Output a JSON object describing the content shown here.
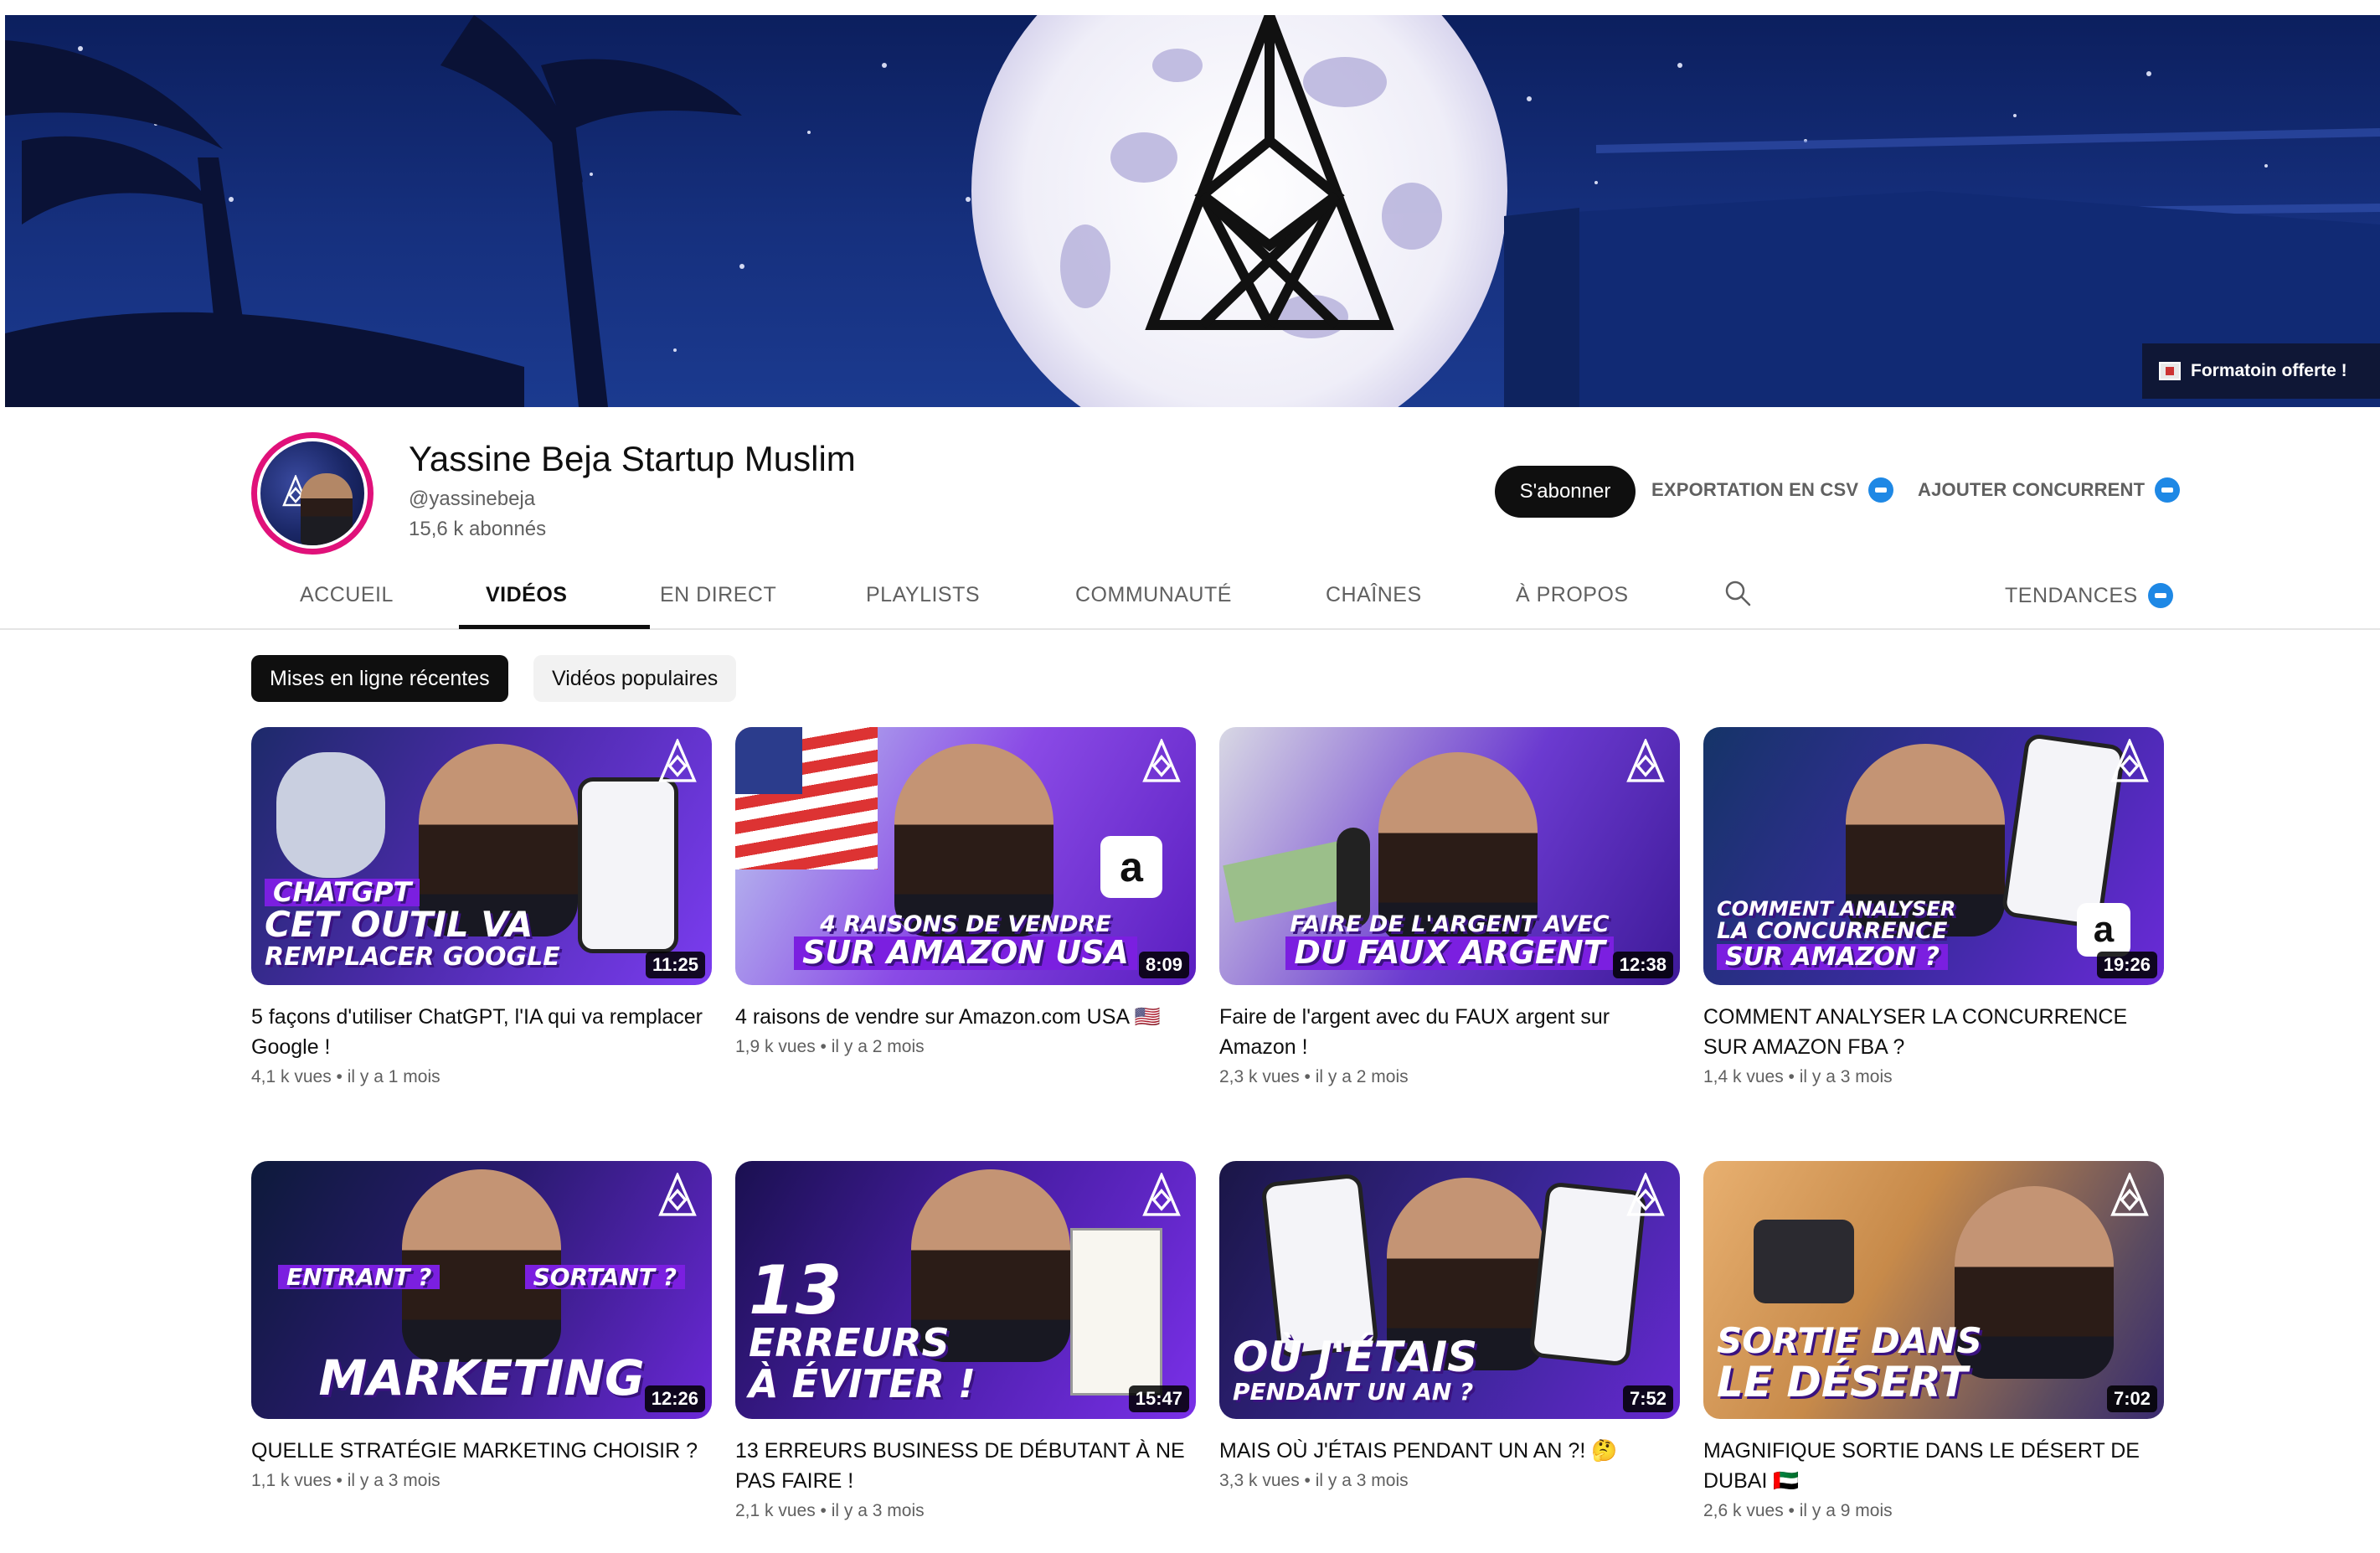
{
  "banner": {
    "promo_label": "Formatoin offerte !"
  },
  "channel": {
    "name": "Yassine Beja Startup Muslim",
    "handle": "@yassinebeja",
    "subscribers": "15,6 k abonnés"
  },
  "actions": {
    "subscribe_label": "S'abonner",
    "export_label": "EXPORTATION EN CSV",
    "add_competitor_label": "AJOUTER CONCURRENT"
  },
  "tabs": [
    {
      "label": "ACCUEIL"
    },
    {
      "label": "VIDÉOS"
    },
    {
      "label": "EN DIRECT"
    },
    {
      "label": "PLAYLISTS"
    },
    {
      "label": "COMMUNAUTÉ"
    },
    {
      "label": "CHAÎNES"
    },
    {
      "label": "À PROPOS"
    }
  ],
  "trends_label": "TENDANCES",
  "chips": [
    {
      "label": "Mises en ligne récentes"
    },
    {
      "label": "Vidéos populaires"
    }
  ],
  "videos": [
    {
      "title": "5 façons d'utiliser ChatGPT, l'IA qui va remplacer Google !",
      "meta": "4,1 k vues • il y a 1 mois",
      "duration": "11:25",
      "thumb_lines": [
        "CHATGPT",
        "CET OUTIL VA",
        "REMPLACER GOOGLE"
      ]
    },
    {
      "title": "4 raisons de vendre sur Amazon.com USA 🇺🇸",
      "meta": "1,9 k vues • il y a 2 mois",
      "duration": "8:09",
      "thumb_lines": [
        "4 RAISONS DE VENDRE",
        "SUR AMAZON USA"
      ]
    },
    {
      "title": "Faire de l'argent avec du FAUX argent sur Amazon !",
      "meta": "2,3 k vues • il y a 2 mois",
      "duration": "12:38",
      "thumb_lines": [
        "FAIRE DE L'ARGENT AVEC",
        "DU FAUX ARGENT"
      ]
    },
    {
      "title": "COMMENT ANALYSER LA CONCURRENCE SUR AMAZON FBA ?",
      "meta": "1,4 k vues • il y a 3 mois",
      "duration": "19:26",
      "thumb_lines": [
        "COMMENT ANALYSER",
        "LA CONCURRENCE",
        "SUR AMAZON ?"
      ]
    },
    {
      "title": "QUELLE STRATÉGIE MARKETING CHOISIR ?",
      "meta": "1,1 k vues • il y a 3 mois",
      "duration": "12:26",
      "thumb_lines": [
        "ENTRANT ?",
        "SORTANT ?",
        "MARKETING"
      ]
    },
    {
      "title": "13 ERREURS BUSINESS DE DÉBUTANT À NE PAS FAIRE !",
      "meta": "2,1 k vues • il y a 3 mois",
      "duration": "15:47",
      "thumb_lines": [
        "13",
        "ERREURS",
        "À ÉVITER !"
      ]
    },
    {
      "title": "MAIS OÙ J'ÉTAIS PENDANT UN AN ?! 🤔",
      "meta": "3,3 k vues • il y a 3 mois",
      "duration": "7:52",
      "thumb_lines": [
        "OÙ J'ÉTAIS",
        "PENDANT UN AN ?"
      ]
    },
    {
      "title": "MAGNIFIQUE SORTIE DANS LE DÉSERT DE DUBAI 🇦🇪",
      "meta": "2,6 k vues • il y a 9 mois",
      "duration": "7:02",
      "thumb_lines": [
        "SORTIE DANS",
        "LE DÉSERT"
      ]
    }
  ],
  "colors": {
    "accent_purple": "#7b1fe0",
    "avatar_ring": "#e0117a",
    "extension_blue": "#1e88e5"
  }
}
